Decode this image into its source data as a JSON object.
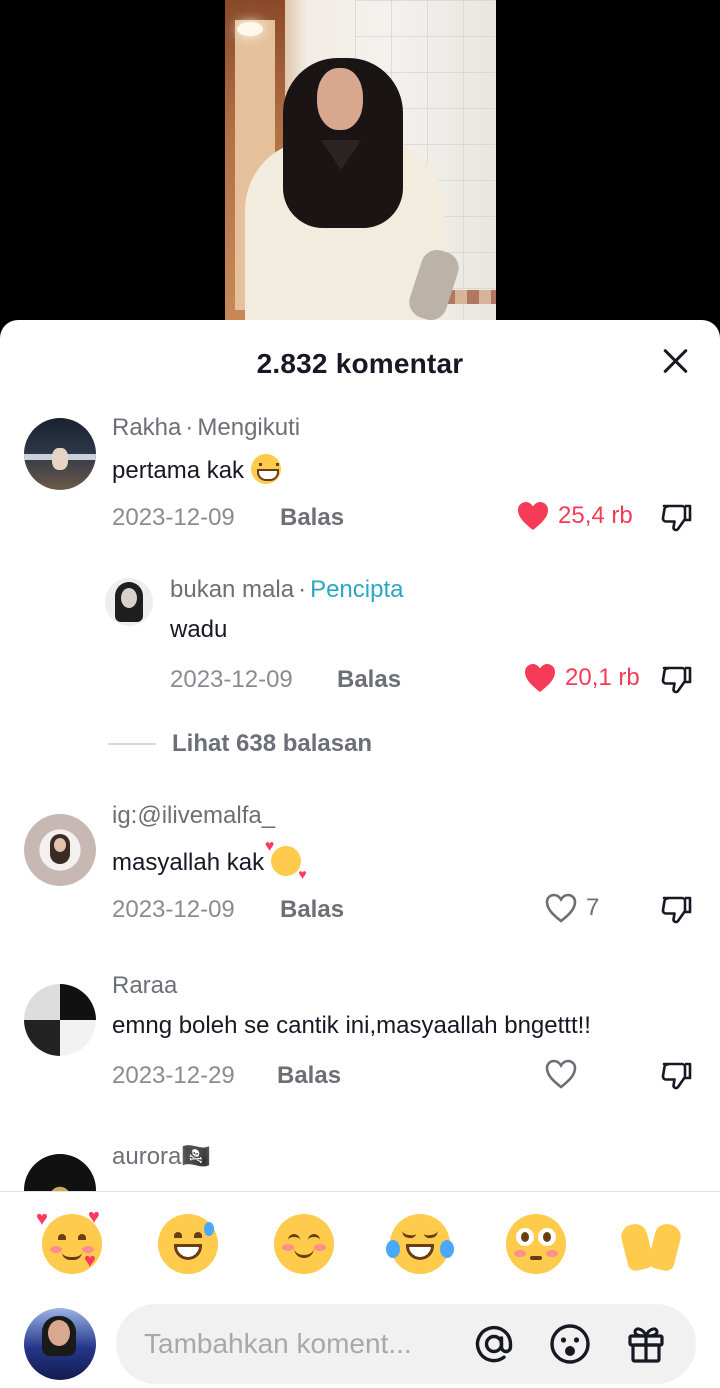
{
  "sheet": {
    "title": "2.832 komentar"
  },
  "comments": [
    {
      "username": "Rakha",
      "tag": "Mengikuti",
      "text": "pertama kak",
      "emoji": "beaming-face",
      "date": "2023-12-09",
      "reply_label": "Balas",
      "likes": "25,4 rb",
      "liked": true
    },
    {
      "username": "bukan mala",
      "tag": "Pencipta",
      "text": "wadu",
      "date": "2023-12-09",
      "reply_label": "Balas",
      "likes": "20,1 rb",
      "liked": true,
      "is_reply": true
    },
    {
      "username": "ig:@ilivemalfa_",
      "text": "masyallah kak",
      "emoji": "smiling-face-with-hearts",
      "date": "2023-12-09",
      "reply_label": "Balas",
      "likes": "7",
      "liked": false
    },
    {
      "username": "Raraa",
      "text": "emng boleh se cantik ini,masyaallah bngettt!!",
      "date": "2023-12-29",
      "reply_label": "Balas",
      "likes": "",
      "liked": false
    },
    {
      "username": "aurora🏴‍☠️"
    }
  ],
  "view_replies": {
    "label": "Lihat 638 balasan"
  },
  "quick_emojis": [
    "smiling-face-with-hearts",
    "grinning-face-with-sweat",
    "smiling-face",
    "face-with-tears-of-joy",
    "flushed-face",
    "palms-up-together"
  ],
  "composer": {
    "placeholder": "Tambahkan koment...",
    "icons": [
      "at-sign-icon",
      "emoji-icon",
      "gift-icon"
    ]
  },
  "colors": {
    "like_active": "#f53b57",
    "creator_tag": "#2ba7c4",
    "text_primary": "#161823",
    "text_secondary": "#6e6f76"
  }
}
